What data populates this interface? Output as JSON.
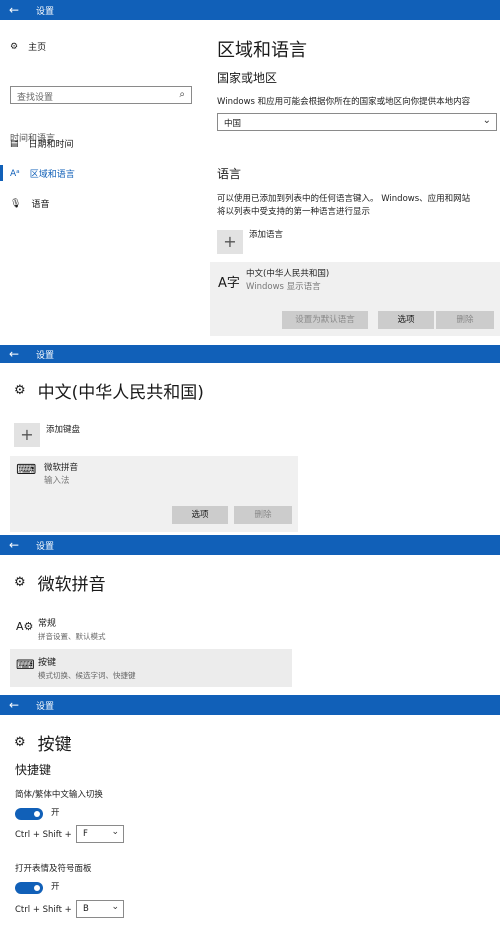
{
  "app": {
    "title": "设置"
  },
  "panel1": {
    "sidebar": {
      "home": "主页",
      "search_placeholder": "查找设置",
      "section": "时间和语言",
      "items": [
        {
          "label": "日期和时间",
          "icon": "calendar-clock-icon"
        },
        {
          "label": "区域和语言",
          "icon": "region-language-icon",
          "active": true
        },
        {
          "label": "语音",
          "icon": "microphone-icon"
        }
      ]
    },
    "main": {
      "title": "区域和语言",
      "region_heading": "国家或地区",
      "region_desc": "Windows 和应用可能会根据你所在的国家或地区向你提供本地内容",
      "region_value": "中国",
      "language_heading": "语言",
      "language_desc_1": "可以使用已添加到列表中的任何语言键入。 Windows、应用和网站",
      "language_desc_2": "将以列表中受支持的第一种语言进行显示",
      "add_language": "添加语言",
      "language_item": {
        "name": "中文(中华人民共和国)",
        "sub": "Windows 显示语言"
      },
      "buttons": {
        "set_default": "设置为默认语言",
        "options": "选项",
        "remove": "删除"
      }
    }
  },
  "panel2": {
    "title": "中文(中华人民共和国)",
    "add_keyboard": "添加键盘",
    "keyboard_item": {
      "name": "微软拼音",
      "sub": "输入法"
    },
    "buttons": {
      "options": "选项",
      "remove": "删除"
    }
  },
  "panel3": {
    "title": "微软拼音",
    "items": [
      {
        "name": "常规",
        "sub": "拼音设置、默认模式",
        "icon": "font-settings-icon"
      },
      {
        "name": "按键",
        "sub": "模式切换、候选字词、快捷键",
        "icon": "keyboard-icon",
        "selected": true
      }
    ]
  },
  "panel4": {
    "title": "按键",
    "section": "快捷键",
    "settings": [
      {
        "label": "简体/繁体中文输入切换",
        "toggle_state": "开",
        "prefix": "Ctrl + Shift +",
        "key": "F"
      },
      {
        "label": "打开表情及符号面板",
        "toggle_state": "开",
        "prefix": "Ctrl + Shift +",
        "key": "B"
      }
    ]
  },
  "colors": {
    "accent": "#1160b8",
    "card": "#f0f0f0",
    "button": "#cccccc"
  }
}
